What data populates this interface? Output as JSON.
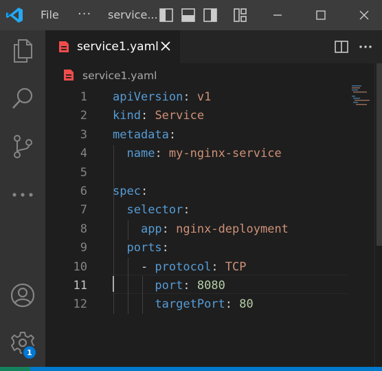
{
  "window": {
    "menu_file": "File",
    "menu_more": "···",
    "title": "service..."
  },
  "activity_bar": {
    "items": [
      {
        "name": "explorer",
        "icon": "files-icon"
      },
      {
        "name": "search",
        "icon": "search-icon"
      },
      {
        "name": "source-control",
        "icon": "source-control-icon"
      },
      {
        "name": "more",
        "icon": "ellipsis-icon"
      },
      {
        "name": "accounts",
        "icon": "account-icon"
      },
      {
        "name": "manage",
        "icon": "gear-icon"
      }
    ],
    "manage_badge": "1"
  },
  "tabs": [
    {
      "label": "service1.yaml",
      "active": true
    }
  ],
  "breadcrumb": {
    "file": "service1.yaml"
  },
  "editor": {
    "active_line": 11,
    "lines": [
      {
        "num": "1",
        "tokens": [
          [
            "k",
            "apiVersion"
          ],
          [
            "p",
            ": "
          ],
          [
            "v",
            "v1"
          ]
        ]
      },
      {
        "num": "2",
        "tokens": [
          [
            "k",
            "kind"
          ],
          [
            "p",
            ": "
          ],
          [
            "v",
            "Service"
          ]
        ]
      },
      {
        "num": "3",
        "tokens": [
          [
            "k",
            "metadata"
          ],
          [
            "p",
            ":"
          ]
        ]
      },
      {
        "num": "4",
        "tokens": [
          [
            "p",
            "  "
          ],
          [
            "k",
            "name"
          ],
          [
            "p",
            ": "
          ],
          [
            "v",
            "my-nginx-service"
          ]
        ]
      },
      {
        "num": "5",
        "tokens": []
      },
      {
        "num": "6",
        "tokens": [
          [
            "k",
            "spec"
          ],
          [
            "p",
            ":"
          ]
        ]
      },
      {
        "num": "7",
        "tokens": [
          [
            "p",
            "  "
          ],
          [
            "k",
            "selector"
          ],
          [
            "p",
            ":"
          ]
        ]
      },
      {
        "num": "8",
        "tokens": [
          [
            "p",
            "    "
          ],
          [
            "k",
            "app"
          ],
          [
            "p",
            ": "
          ],
          [
            "v",
            "nginx-deployment"
          ]
        ]
      },
      {
        "num": "9",
        "tokens": [
          [
            "p",
            "  "
          ],
          [
            "k",
            "ports"
          ],
          [
            "p",
            ":"
          ]
        ]
      },
      {
        "num": "10",
        "tokens": [
          [
            "p",
            "    - "
          ],
          [
            "k",
            "protocol"
          ],
          [
            "p",
            ": "
          ],
          [
            "v",
            "TCP"
          ]
        ]
      },
      {
        "num": "11",
        "tokens": [
          [
            "p",
            "      "
          ],
          [
            "k",
            "port"
          ],
          [
            "p",
            ": "
          ],
          [
            "n",
            "8080"
          ]
        ]
      },
      {
        "num": "12",
        "tokens": [
          [
            "p",
            "      "
          ],
          [
            "k",
            "targetPort"
          ],
          [
            "p",
            ": "
          ],
          [
            "n",
            "80"
          ]
        ]
      }
    ]
  },
  "colors": {
    "key": "#569cd6",
    "string": "#ce9178",
    "number": "#b5cea8",
    "status_bar": "#007acc",
    "badge": "#0078d4",
    "yaml_icon": "#f14c4c"
  }
}
